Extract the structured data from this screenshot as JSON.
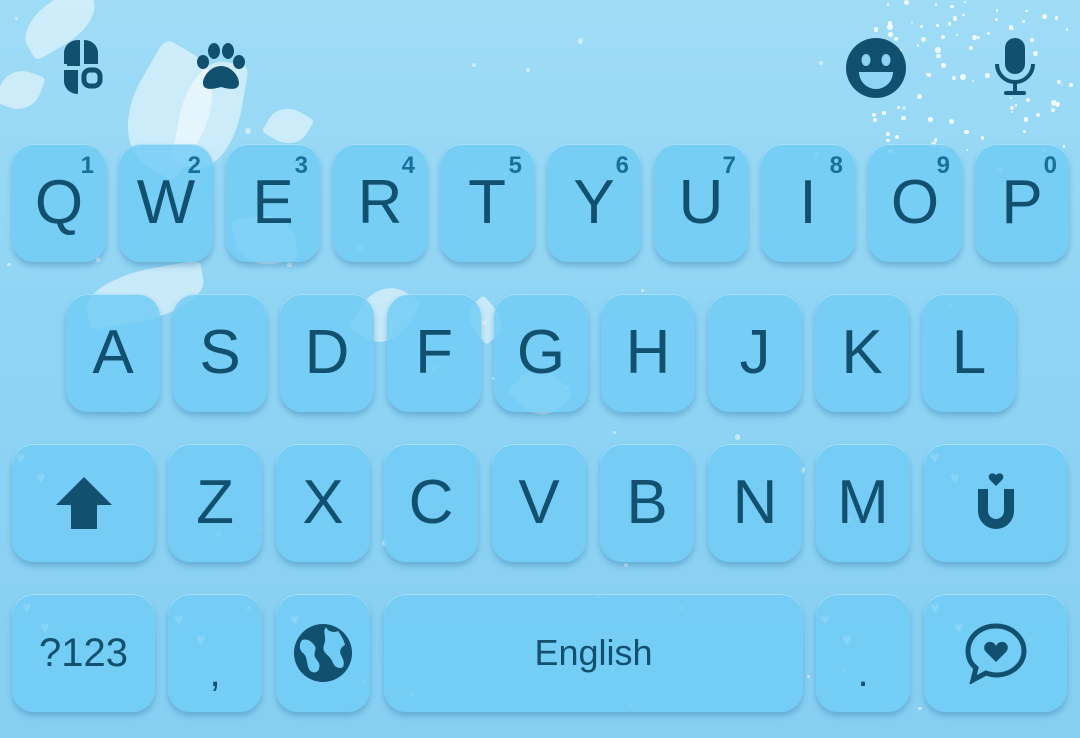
{
  "colors": {
    "background": "#8fd4f4",
    "key": "#70ccf5",
    "key_text": "#12506f",
    "hint_text": "#1a6f9b"
  },
  "toolbar": {
    "left_icons": [
      "clover-icon",
      "paw-icon"
    ],
    "right_icons": [
      "emoji-smile-icon",
      "microphone-icon"
    ]
  },
  "rows": {
    "row1": [
      {
        "letter": "Q",
        "hint": "1"
      },
      {
        "letter": "W",
        "hint": "2"
      },
      {
        "letter": "E",
        "hint": "3"
      },
      {
        "letter": "R",
        "hint": "4"
      },
      {
        "letter": "T",
        "hint": "5"
      },
      {
        "letter": "Y",
        "hint": "6"
      },
      {
        "letter": "U",
        "hint": "7"
      },
      {
        "letter": "I",
        "hint": "8"
      },
      {
        "letter": "O",
        "hint": "9"
      },
      {
        "letter": "P",
        "hint": "0"
      }
    ],
    "row2": [
      "A",
      "S",
      "D",
      "F",
      "G",
      "H",
      "J",
      "K",
      "L"
    ],
    "row3": [
      "Z",
      "X",
      "C",
      "V",
      "B",
      "N",
      "M"
    ],
    "row4": {
      "symbols_label": "?123",
      "comma_label": ",",
      "space_label": "English",
      "period_label": "."
    }
  },
  "special_icons": {
    "shift": "shift-arrow-icon",
    "magnet": "magnet-icon",
    "globe": "globe-icon",
    "chat_heart": "chat-heart-icon"
  }
}
